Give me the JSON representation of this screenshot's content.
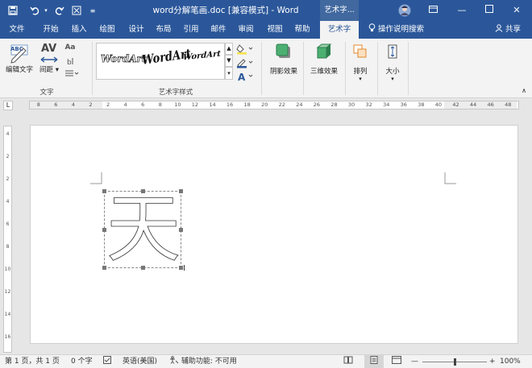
{
  "titlebar": {
    "doc_title": "word分解笔画.doc [兼容模式] - Word",
    "context_tool": "艺术字...",
    "icons": [
      "save-icon",
      "undo-icon",
      "redo-icon",
      "format-painter-icon",
      "customize-icon",
      "avatar",
      "ribbon-display-icon",
      "minimize-icon",
      "maximize-icon",
      "close-icon"
    ]
  },
  "tabs": [
    {
      "label": "文件"
    },
    {
      "label": "开始"
    },
    {
      "label": "插入"
    },
    {
      "label": "绘图"
    },
    {
      "label": "设计"
    },
    {
      "label": "布局"
    },
    {
      "label": "引用"
    },
    {
      "label": "邮件"
    },
    {
      "label": "审阅"
    },
    {
      "label": "视图"
    },
    {
      "label": "帮助"
    },
    {
      "label": "艺术字"
    }
  ],
  "tell_me": "操作说明搜索",
  "share": "共享",
  "ribbon": {
    "edit_text": "编辑文字",
    "spacing": "间距",
    "group_text": "文字",
    "gallery_items": [
      "WordArt",
      "WordArt",
      "WordArt"
    ],
    "group_styles": "艺术字样式",
    "shadow": "阴影效果",
    "three_d": "三维效果",
    "arrange": "排列",
    "size": "大小",
    "abc": "ABC",
    "av": "AV",
    "aa": "Aa"
  },
  "ruler": {
    "h_labels": [
      "8",
      "6",
      "4",
      "2",
      "2",
      "4",
      "6",
      "8",
      "10",
      "12",
      "14",
      "16",
      "18",
      "20",
      "22",
      "24",
      "26",
      "28",
      "30",
      "32",
      "34",
      "36",
      "38",
      "40",
      "42",
      "44",
      "46",
      "48"
    ],
    "v_labels": [
      "4",
      "2",
      "2",
      "4",
      "6",
      "8",
      "10",
      "12",
      "14",
      "16"
    ]
  },
  "document": {
    "wordart_char": "天"
  },
  "status": {
    "page": "第 1 页，共 1 页",
    "words": "0 个字",
    "language": "英语(美国)",
    "accessibility": "辅助功能: 不可用",
    "zoom": "100%",
    "zoom_level": 1.0
  }
}
